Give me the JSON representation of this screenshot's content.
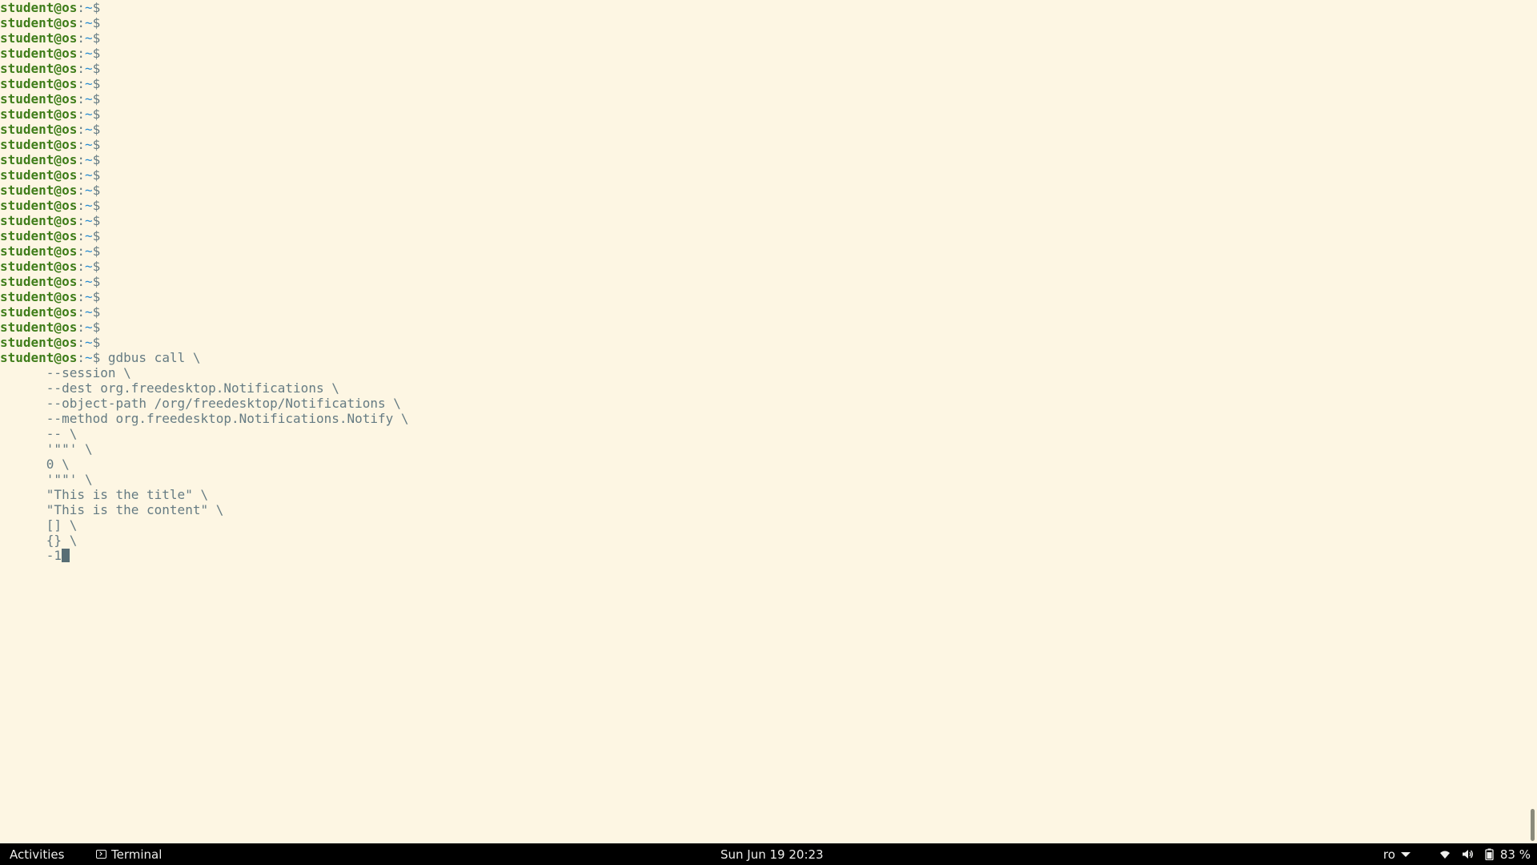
{
  "terminal": {
    "prompt": {
      "user": "student@os",
      "separator": ":",
      "path": "~",
      "dollar": "$"
    },
    "empty_prompts": 23,
    "command_first_line": "gdbus call \\",
    "continuation_lines": [
      "      --session \\",
      "      --dest org.freedesktop.Notifications \\",
      "      --object-path /org/freedesktop/Notifications \\",
      "      --method org.freedesktop.Notifications.Notify \\",
      "      -- \\",
      "      '\"\"' \\",
      "      0 \\",
      "      '\"\"' \\",
      "      \"This is the title\" \\",
      "      \"This is the content\" \\",
      "      [] \\",
      "      {} \\"
    ],
    "last_line": "      -1"
  },
  "taskbar": {
    "activities": "Activities",
    "app_name": "Terminal",
    "clock": "Sun Jun 19  20:23",
    "language": "ro",
    "battery": "83 %"
  },
  "colors": {
    "background": "#fdf6e3",
    "prompt_user": "#3f7d1a",
    "prompt_path": "#268bd2",
    "text": "#657b83",
    "taskbar": "#000000"
  }
}
